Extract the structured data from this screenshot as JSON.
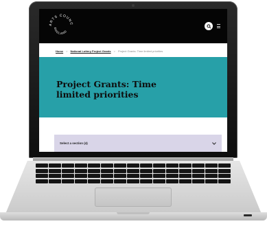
{
  "site": {
    "logo_text": "ARTS COUNCIL ENGLAND"
  },
  "header": {
    "search_icon": "search-icon",
    "menu_icon": "menu-icon"
  },
  "breadcrumb": {
    "home": "Home",
    "parent": "National Lottery Project Grants",
    "current": "Project Grants: Time limited priorities",
    "separator": ">"
  },
  "hero": {
    "title": "Project Grants: Time limited priorities",
    "background": "#27a0a8"
  },
  "section_select": {
    "label": "Select a section (4)",
    "background": "#d9d5e8",
    "chevron_icon": "chevron-down-icon"
  }
}
